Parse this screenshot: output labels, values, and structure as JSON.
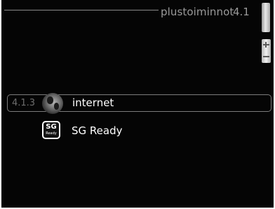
{
  "header": {
    "title": "plustoiminnot",
    "menu_number": "4.1"
  },
  "menu": {
    "items": [
      {
        "number": "4.1.3",
        "label": "internet",
        "icon": "globe-icon",
        "selected": true
      },
      {
        "number": "",
        "label": "SG Ready",
        "icon": "sg-ready-icon",
        "selected": false
      }
    ]
  },
  "sg_icon": {
    "big_text": "SG",
    "small_text": "Ready"
  },
  "colors": {
    "background": "#050505",
    "text": "#ffffff",
    "muted_text": "#9a9a9a",
    "selection_border": "#7c7c7c"
  }
}
